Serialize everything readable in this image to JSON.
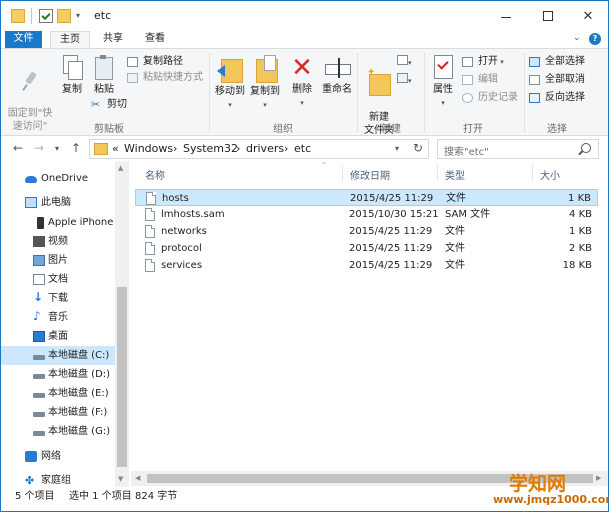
{
  "window": {
    "title": "etc"
  },
  "ribbon_tabs": {
    "file": "文件",
    "home": "主页",
    "share": "共享",
    "view": "查看"
  },
  "ribbon": {
    "clipboard": {
      "label": "剪贴板",
      "pin": "固定到\"快\n速访问\"",
      "copy": "复制",
      "paste": "粘贴",
      "copy_path": "复制路径",
      "paste_shortcut": "粘贴快捷方式",
      "cut": "剪切"
    },
    "organize": {
      "label": "组织",
      "move_to": "移动到",
      "copy_to": "复制到",
      "delete": "删除",
      "rename": "重命名"
    },
    "new": {
      "label": "新建",
      "new_folder": "新建\n文件夹"
    },
    "open": {
      "label": "打开",
      "properties": "属性",
      "open": "打开",
      "edit": "编辑",
      "history": "历史记录"
    },
    "select": {
      "label": "选择",
      "select_all": "全部选择",
      "select_none": "全部取消",
      "invert": "反向选择"
    }
  },
  "address": {
    "prefix": "«",
    "segments": [
      "Windows",
      "System32",
      "drivers",
      "etc"
    ],
    "separator": "›"
  },
  "search": {
    "placeholder": "搜索\"etc\""
  },
  "nav_pane": {
    "items": [
      {
        "label": "OneDrive",
        "icon": "cloud-icon"
      },
      {
        "label": "此电脑",
        "icon": "computer-icon"
      },
      {
        "label": "Apple iPhone",
        "icon": "phone-icon"
      },
      {
        "label": "视频",
        "icon": "video-icon"
      },
      {
        "label": "图片",
        "icon": "pictures-icon"
      },
      {
        "label": "文档",
        "icon": "documents-icon"
      },
      {
        "label": "下载",
        "icon": "download-icon"
      },
      {
        "label": "音乐",
        "icon": "music-icon"
      },
      {
        "label": "桌面",
        "icon": "desktop-icon"
      },
      {
        "label": "本地磁盘 (C:)",
        "icon": "drive-icon",
        "selected": true
      },
      {
        "label": "本地磁盘 (D:)",
        "icon": "drive-icon"
      },
      {
        "label": "本地磁盘 (E:)",
        "icon": "drive-icon"
      },
      {
        "label": "本地磁盘 (F:)",
        "icon": "drive-icon"
      },
      {
        "label": "本地磁盘 (G:)",
        "icon": "drive-icon"
      },
      {
        "label": "网络",
        "icon": "network-icon"
      },
      {
        "label": "家庭组",
        "icon": "homegroup-icon"
      }
    ]
  },
  "columns": {
    "name": "名称",
    "modified": "修改日期",
    "type": "类型",
    "size": "大小"
  },
  "files": [
    {
      "name": "hosts",
      "modified": "2015/4/25 11:29",
      "type": "文件",
      "size": "1 KB",
      "selected": true
    },
    {
      "name": "lmhosts.sam",
      "modified": "2015/10/30 15:21",
      "type": "SAM 文件",
      "size": "4 KB"
    },
    {
      "name": "networks",
      "modified": "2015/4/25 11:29",
      "type": "文件",
      "size": "1 KB"
    },
    {
      "name": "protocol",
      "modified": "2015/4/25 11:29",
      "type": "文件",
      "size": "2 KB"
    },
    {
      "name": "services",
      "modified": "2015/4/25 11:29",
      "type": "文件",
      "size": "18 KB"
    }
  ],
  "status": {
    "count": "5 个项目",
    "selected": "选中 1 个项目",
    "size": "824 字节"
  },
  "watermark": {
    "brand": "学知网",
    "url": "www.jmqz1000.com"
  },
  "colors": {
    "accent": "#1979ca",
    "selection": "#cce8ff",
    "watermark": "#e07b00"
  }
}
